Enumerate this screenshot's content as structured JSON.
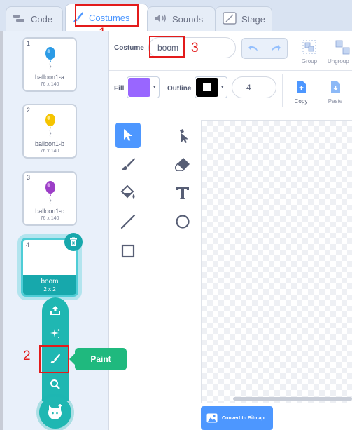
{
  "tabs": {
    "code": "Code",
    "costumes": "Costumes",
    "sounds": "Sounds",
    "stage": "Stage"
  },
  "annotations": [
    "1",
    "2",
    "3"
  ],
  "costumes": [
    {
      "num": "1",
      "name": "balloon1-a",
      "size": "76 x 140",
      "color": "#2b9be6"
    },
    {
      "num": "2",
      "name": "balloon1-b",
      "size": "76 x 140",
      "color": "#f5c400"
    },
    {
      "num": "3",
      "name": "balloon1-c",
      "size": "76 x 140",
      "color": "#9c3ec7"
    },
    {
      "num": "4",
      "name": "boom",
      "size": "2 x 2",
      "selected": true
    }
  ],
  "editor": {
    "costume_label": "Costume",
    "costume_name": "boom",
    "group_label": "Group",
    "ungroup_label": "Ungroup",
    "fill_label": "Fill",
    "fill_color": "#9966ff",
    "outline_label": "Outline",
    "outline_color": "#000000",
    "outline_width": "4",
    "copy_label": "Copy",
    "paste_label": "Paste",
    "convert_label": "Convert to Bitmap"
  },
  "tooltip": "Paint",
  "tools": [
    "select",
    "reshape",
    "brush",
    "eraser",
    "fill",
    "text",
    "line",
    "circle",
    "rectangle"
  ]
}
